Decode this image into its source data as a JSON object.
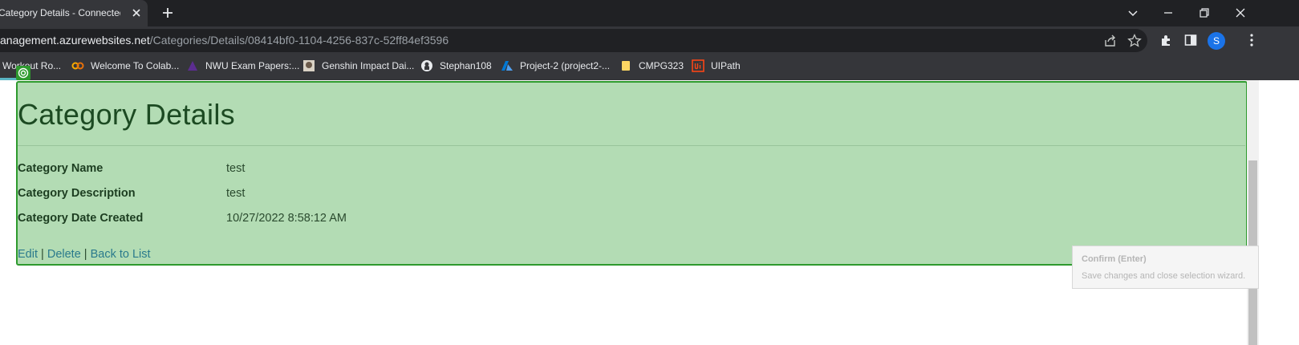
{
  "browser": {
    "tab_title": "Category Details - Connected Of",
    "address_host": "anagement.azurewebsites.net",
    "address_path": "/Categories/Details/08414bf0-1104-4256-837c-52ff84ef3596",
    "profile_initial": "S",
    "bookmarks": [
      {
        "label": "Workout Ro...",
        "icon": "workout-icon"
      },
      {
        "label": "Welcome To Colab...",
        "icon": "colab-icon"
      },
      {
        "label": "NWU Exam Papers:...",
        "icon": "nwu-icon"
      },
      {
        "label": "Genshin Impact Dai...",
        "icon": "genshin-icon"
      },
      {
        "label": "Stephan108",
        "icon": "github-icon"
      },
      {
        "label": "Project-2 (project2-...",
        "icon": "azure-icon"
      },
      {
        "label": "CMPG323",
        "icon": "folder-icon"
      },
      {
        "label": "UIPath",
        "icon": "uipath-icon"
      }
    ]
  },
  "page": {
    "heading": "Category Details",
    "fields": [
      {
        "label": "Category Name",
        "value": "test"
      },
      {
        "label": "Category Description",
        "value": "test"
      },
      {
        "label": "Category Date Created",
        "value": "10/27/2022 8:58:12 AM"
      }
    ],
    "links": {
      "edit": "Edit",
      "delete": "Delete",
      "back": "Back to List",
      "separator": "|"
    }
  },
  "tooltip": {
    "title": "Confirm (Enter)",
    "description": "Save changes and close selection wizard."
  },
  "colors": {
    "selection_fill": "#b3dcb4",
    "selection_border": "#2e9a2e",
    "link": "#2a7a8c",
    "heading": "#1c4a22"
  }
}
